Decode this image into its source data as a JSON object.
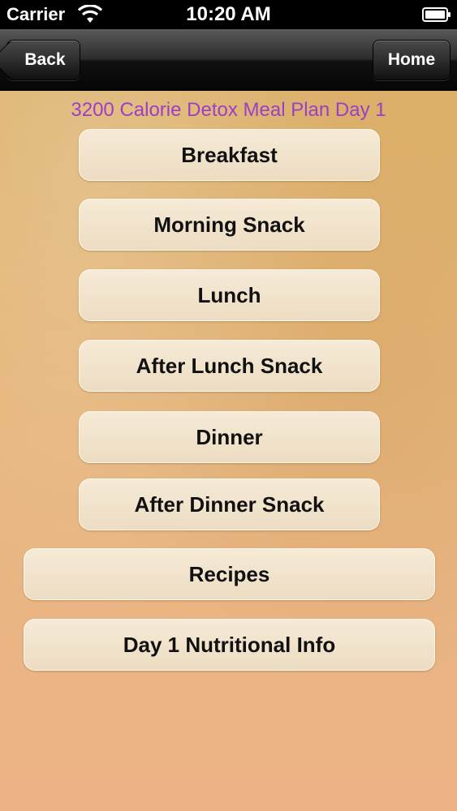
{
  "status_bar": {
    "carrier": "Carrier",
    "time": "10:20 AM"
  },
  "nav": {
    "back_label": "Back",
    "home_label": "Home"
  },
  "page": {
    "title": "3200 Calorie Detox Meal Plan Day 1",
    "title_color": "#9b3fc7"
  },
  "menu": {
    "items": [
      {
        "label": "Breakfast"
      },
      {
        "label": "Morning Snack"
      },
      {
        "label": "Lunch"
      },
      {
        "label": "After Lunch Snack"
      },
      {
        "label": "Dinner"
      },
      {
        "label": "After Dinner Snack"
      },
      {
        "label": "Recipes"
      },
      {
        "label": "Day 1 Nutritional Info"
      }
    ]
  }
}
